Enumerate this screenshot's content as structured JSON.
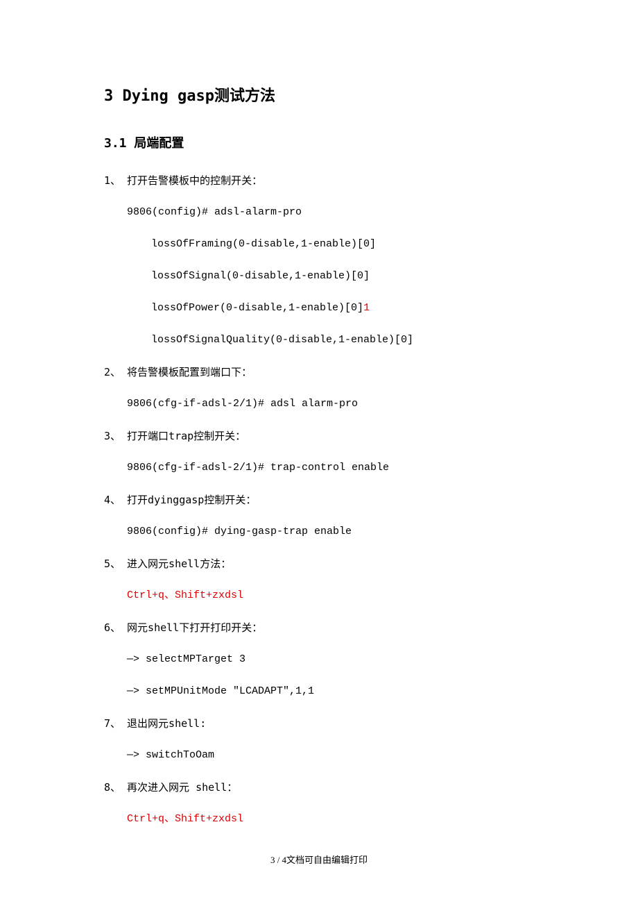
{
  "h1": "3  Dying gasp测试方法",
  "h2": "3.1 局端配置",
  "items": {
    "i1": {
      "title": "1、 打开告警模板中的控制开关：",
      "cmd": "9806(config)# adsl-alarm-pro",
      "sub1": "lossOfFraming(0-disable,1-enable)[0]",
      "sub2": "lossOfSignal(0-disable,1-enable)[0]",
      "sub3a": "lossOfPower(0-disable,1-enable)[0]",
      "sub3b": "1",
      "sub4": "lossOfSignalQuality(0-disable,1-enable)[0]"
    },
    "i2": {
      "title": "2、 将告警模板配置到端口下：",
      "cmd": "9806(cfg-if-adsl-2/1)# adsl alarm-pro"
    },
    "i3": {
      "title": "3、 打开端口trap控制开关：",
      "cmd": "9806(cfg-if-adsl-2/1)# trap-control enable"
    },
    "i4": {
      "title": "4、 打开dyinggasp控制开关：",
      "cmd": "9806(config)# dying-gasp-trap enable"
    },
    "i5": {
      "title": "5、 进入网元shell方法：",
      "cmd": "Ctrl+q、Shift+zxdsl"
    },
    "i6": {
      "title": "6、 网元shell下打开打印开关：",
      "cmd1": "—> selectMPTarget  3",
      "cmd2": "—> setMPUnitMode  \"LCADAPT\",1,1"
    },
    "i7": {
      "title": "7、 退出网元shell:",
      "cmd": "—> switchToOam"
    },
    "i8": {
      "title": "8、 再次进入网元 shell：",
      "cmd": "Ctrl+q、Shift+zxdsl"
    }
  },
  "footer": "3 / 4文档可自由编辑打印"
}
